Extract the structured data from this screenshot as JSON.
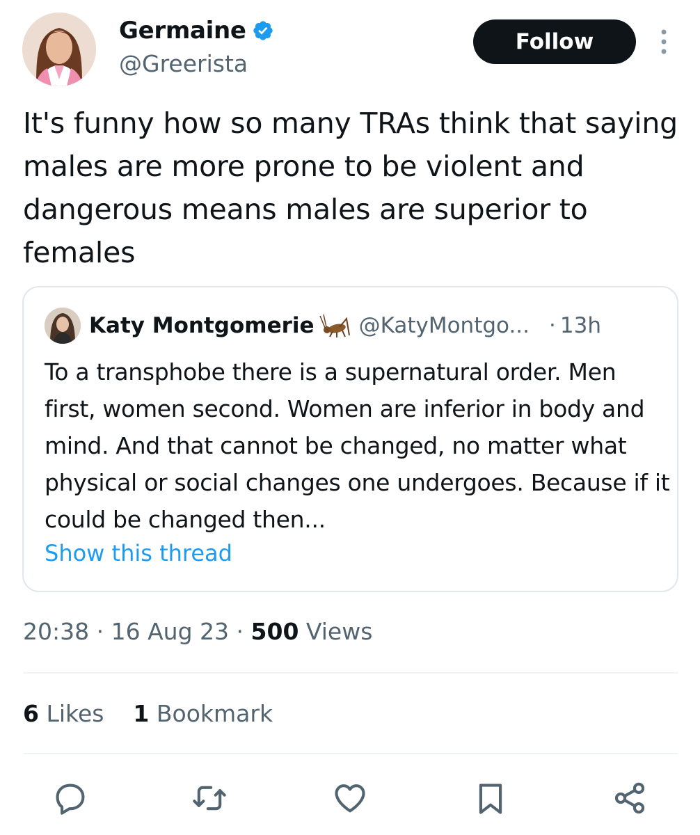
{
  "author": {
    "name": "Germaine",
    "handle": "@Greerista",
    "verified": true
  },
  "follow_label": "Follow",
  "tweet_text": "It's funny how so many TRAs think that saying males are more prone to be violent and dangerous means males are superior to females",
  "quoted_tweet": {
    "name": "Katy Montgomerie",
    "name_emoji": "cricket",
    "handle": "@KatyMontgo...",
    "separator": "·",
    "time": "13h",
    "text": "To a transphobe there is a supernatural order. Men first, women second. Women are inferior in body and mind. And that cannot be changed, no matter what physical or social changes one undergoes. Because if it could be changed then...",
    "show_thread_label": "Show this thread"
  },
  "meta": {
    "time": "20:38",
    "sep1": "·",
    "date": "16 Aug 23",
    "sep2": "·",
    "views_count": "500",
    "views_label": "Views"
  },
  "stats": {
    "likes_count": "6",
    "likes_label": "Likes",
    "bookmarks_count": "1",
    "bookmarks_label": "Bookmark"
  },
  "actions": [
    "reply-icon",
    "retweet-icon",
    "like-icon",
    "bookmark-icon",
    "share-icon"
  ],
  "colors": {
    "text": "#0f1419",
    "secondary": "#536471",
    "link": "#1d9bf0",
    "verified": "#1d9bf0",
    "border": "#e2e7eb",
    "button": "#0f1419"
  }
}
